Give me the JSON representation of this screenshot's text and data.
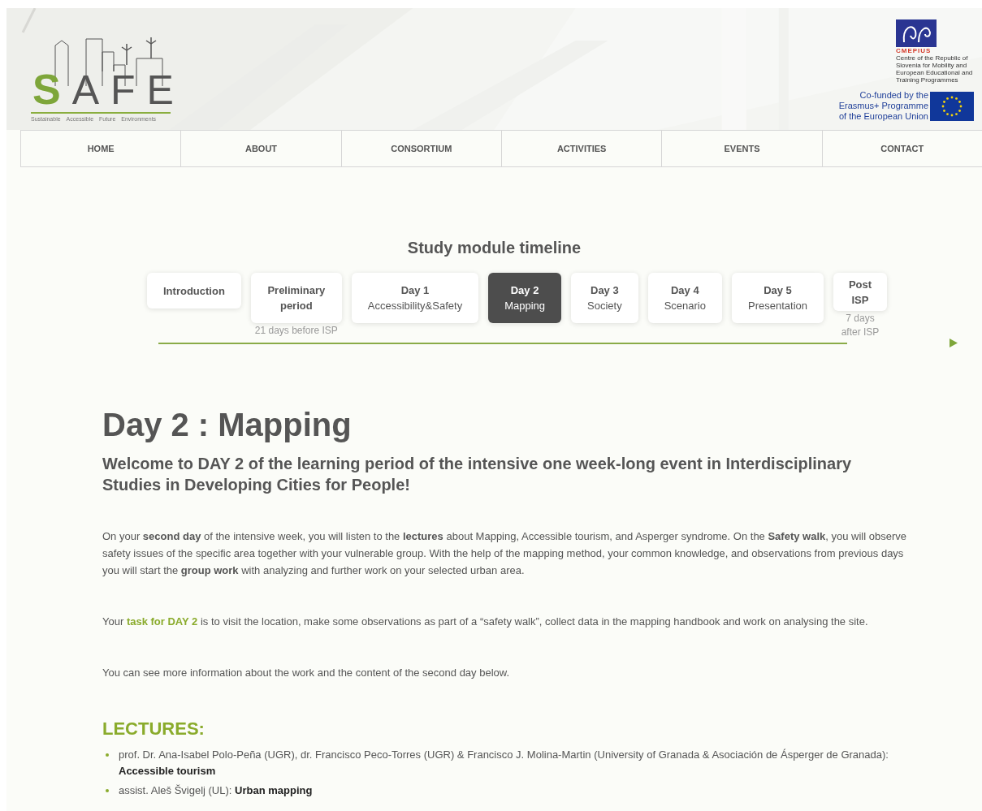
{
  "logo": {
    "letters": [
      "S",
      "A",
      "F",
      "E"
    ],
    "tagline": [
      "Sustainable",
      "Accessible",
      "Future",
      "Environments"
    ]
  },
  "partner": {
    "name": "CMEPIUS",
    "description": "Centre of the Republic of Slovenia for Mobility and European Educational and Training Programmes"
  },
  "eu_notice": [
    "Co-funded by the",
    "Erasmus+ Programme",
    "of the European Union"
  ],
  "nav": [
    "HOME",
    "ABOUT",
    "CONSORTIUM",
    "ACTIVITIES",
    "EVENTS",
    "CONTACT"
  ],
  "timeline": {
    "title": "Study module timeline",
    "items": [
      {
        "title": "Introduction",
        "selected": false
      },
      {
        "title": "Preliminary period",
        "note": "21 days before ISP",
        "selected": false
      },
      {
        "title": "Day 1",
        "subtitle": "Accessibility&Safety",
        "selected": false
      },
      {
        "title": "Day 2",
        "subtitle": "Mapping",
        "selected": true
      },
      {
        "title": "Day 3",
        "subtitle": "Society",
        "selected": false
      },
      {
        "title": "Day 4",
        "subtitle": "Scenario",
        "selected": false
      },
      {
        "title": "Day 5",
        "subtitle": "Presentation",
        "selected": false
      },
      {
        "title": "Post ISP",
        "note": "7 days after ISP",
        "selected": false
      }
    ]
  },
  "heading": "Day 2 : Mapping",
  "subheading": "Welcome to DAY 2 of the learning period of the intensive one week-long event in Interdisciplinary Studies in Developing Cities for People!",
  "paragraphs": [
    [
      {
        "text": "On your **second day** of the intensive week, you will listen to the **lectures** about Mapping, Accessible tourism, and Asperger syndrome. On the **Safety walk**, you will observe safety issues of the specific area together with your vulnerable group. With the help of the mapping method, your common knowledge, and observations from previous days you will start the **group work** with analyzing and further work on your selected urban area."
      }
    ],
    [
      {
        "text": "Your "
      },
      {
        "text": "task for DAY 2",
        "kind": "highlight"
      },
      {
        "text": " is to visit the location, make some observations as part of a “safety walk”, collect data in the mapping handbook and work on analysing the site."
      }
    ],
    [
      {
        "text": "You can see more information about the work and the content of the second day below."
      }
    ]
  ],
  "lectures": {
    "title": "LECTURES:",
    "items": [
      "prof. Dr. Ana-Isabel Polo-Peña (UGR), dr. Francisco Peco-Torres (UGR) & Francisco J. Molina-Martin (University of Granada & Asociación de Ásperger de Granada): **Accessible tourism**",
      "assist. Aleš Švigelj (UL): **Urban mapping**"
    ]
  }
}
